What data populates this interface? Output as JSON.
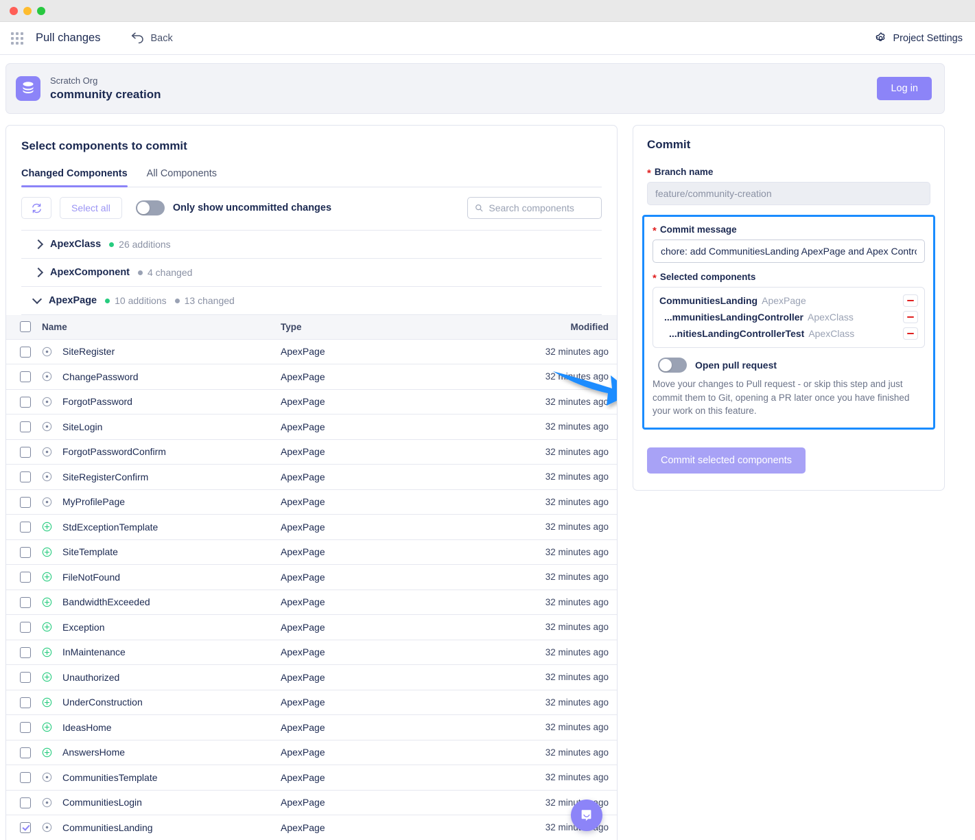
{
  "window": {
    "traffic_lights": [
      "close",
      "minimize",
      "maximize"
    ]
  },
  "topbar": {
    "grid_icon": "app-grid-icon",
    "title": "Pull changes",
    "back_label": "Back",
    "back_icon": "undo-arrow-icon",
    "settings_label": "Project Settings",
    "settings_icon": "gear-icon"
  },
  "org": {
    "icon": "database-stack-icon",
    "type_label": "Scratch Org",
    "name": "community creation",
    "login_label": "Log in"
  },
  "left": {
    "title": "Select components to commit",
    "tabs": [
      {
        "label": "Changed Components",
        "active": true
      },
      {
        "label": "All Components",
        "active": false
      }
    ],
    "toolbar": {
      "refresh_icon": "refresh-icon",
      "select_all_label": "Select all",
      "toggle_label": "Only show uncommitted changes",
      "toggle_on": false
    },
    "search": {
      "placeholder": "Search components",
      "value": "",
      "icon": "search-icon"
    },
    "accordions": [
      {
        "name": "ApexClass",
        "expanded": false,
        "stats": [
          {
            "text": "26 additions",
            "kind": "add"
          }
        ]
      },
      {
        "name": "ApexComponent",
        "expanded": false,
        "stats": [
          {
            "text": "4 changed",
            "kind": "chg"
          }
        ]
      },
      {
        "name": "ApexPage",
        "expanded": true,
        "stats": [
          {
            "text": "10 additions",
            "kind": "add"
          },
          {
            "text": "13 changed",
            "kind": "chg"
          }
        ]
      }
    ],
    "table": {
      "columns": [
        "Name",
        "Type",
        "Modified"
      ],
      "rows": [
        {
          "checked": false,
          "status": "changed",
          "name": "SiteRegister",
          "type": "ApexPage",
          "modified": "32 minutes ago"
        },
        {
          "checked": false,
          "status": "changed",
          "name": "ChangePassword",
          "type": "ApexPage",
          "modified": "32 minutes ago"
        },
        {
          "checked": false,
          "status": "changed",
          "name": "ForgotPassword",
          "type": "ApexPage",
          "modified": "32 minutes ago"
        },
        {
          "checked": false,
          "status": "changed",
          "name": "SiteLogin",
          "type": "ApexPage",
          "modified": "32 minutes ago"
        },
        {
          "checked": false,
          "status": "changed",
          "name": "ForgotPasswordConfirm",
          "type": "ApexPage",
          "modified": "32 minutes ago"
        },
        {
          "checked": false,
          "status": "changed",
          "name": "SiteRegisterConfirm",
          "type": "ApexPage",
          "modified": "32 minutes ago"
        },
        {
          "checked": false,
          "status": "changed",
          "name": "MyProfilePage",
          "type": "ApexPage",
          "modified": "32 minutes ago"
        },
        {
          "checked": false,
          "status": "addition",
          "name": "StdExceptionTemplate",
          "type": "ApexPage",
          "modified": "32 minutes ago"
        },
        {
          "checked": false,
          "status": "addition",
          "name": "SiteTemplate",
          "type": "ApexPage",
          "modified": "32 minutes ago"
        },
        {
          "checked": false,
          "status": "addition",
          "name": "FileNotFound",
          "type": "ApexPage",
          "modified": "32 minutes ago"
        },
        {
          "checked": false,
          "status": "addition",
          "name": "BandwidthExceeded",
          "type": "ApexPage",
          "modified": "32 minutes ago"
        },
        {
          "checked": false,
          "status": "addition",
          "name": "Exception",
          "type": "ApexPage",
          "modified": "32 minutes ago"
        },
        {
          "checked": false,
          "status": "addition",
          "name": "InMaintenance",
          "type": "ApexPage",
          "modified": "32 minutes ago"
        },
        {
          "checked": false,
          "status": "addition",
          "name": "Unauthorized",
          "type": "ApexPage",
          "modified": "32 minutes ago"
        },
        {
          "checked": false,
          "status": "addition",
          "name": "UnderConstruction",
          "type": "ApexPage",
          "modified": "32 minutes ago"
        },
        {
          "checked": false,
          "status": "addition",
          "name": "IdeasHome",
          "type": "ApexPage",
          "modified": "32 minutes ago"
        },
        {
          "checked": false,
          "status": "addition",
          "name": "AnswersHome",
          "type": "ApexPage",
          "modified": "32 minutes ago"
        },
        {
          "checked": false,
          "status": "changed",
          "name": "CommunitiesTemplate",
          "type": "ApexPage",
          "modified": "32 minutes ago"
        },
        {
          "checked": false,
          "status": "changed",
          "name": "CommunitiesLogin",
          "type": "ApexPage",
          "modified": "32 minutes ago"
        },
        {
          "checked": true,
          "status": "changed",
          "name": "CommunitiesLanding",
          "type": "ApexPage",
          "modified": "32 minutes ago"
        }
      ]
    }
  },
  "commit": {
    "title": "Commit",
    "branch_label": "Branch name",
    "branch_value": "feature/community-creation",
    "message_label": "Commit message",
    "message_value": "chore: add CommunitiesLanding ApexPage and Apex Controller",
    "selected_label": "Selected components",
    "selected": [
      {
        "name": "CommunitiesLanding",
        "type": "ApexPage",
        "remove_icon": "minus-icon"
      },
      {
        "name": "...mmunitiesLandingController",
        "type": "ApexClass",
        "remove_icon": "minus-icon"
      },
      {
        "name": "...nitiesLandingControllerTest",
        "type": "ApexClass",
        "remove_icon": "minus-icon"
      }
    ],
    "pr_toggle_label": "Open pull request",
    "pr_toggle_on": false,
    "pr_description": "Move your changes to Pull request - or skip this step and just commit them to Git, opening a PR later once you have finished your work on this feature.",
    "submit_label": "Commit selected components"
  },
  "overlays": {
    "arrow": {
      "color": "#1a8cff",
      "points_to": "commit-message-section"
    },
    "chat": {
      "icon": "chat-bubble-icon",
      "color": "#8c84f8"
    }
  },
  "colors": {
    "accent_purple": "#8c84f8",
    "addition_green": "#27cc7f",
    "changed_gray": "#9aa2b4",
    "highlight_blue": "#1a8cff",
    "required_red": "#e02020"
  }
}
